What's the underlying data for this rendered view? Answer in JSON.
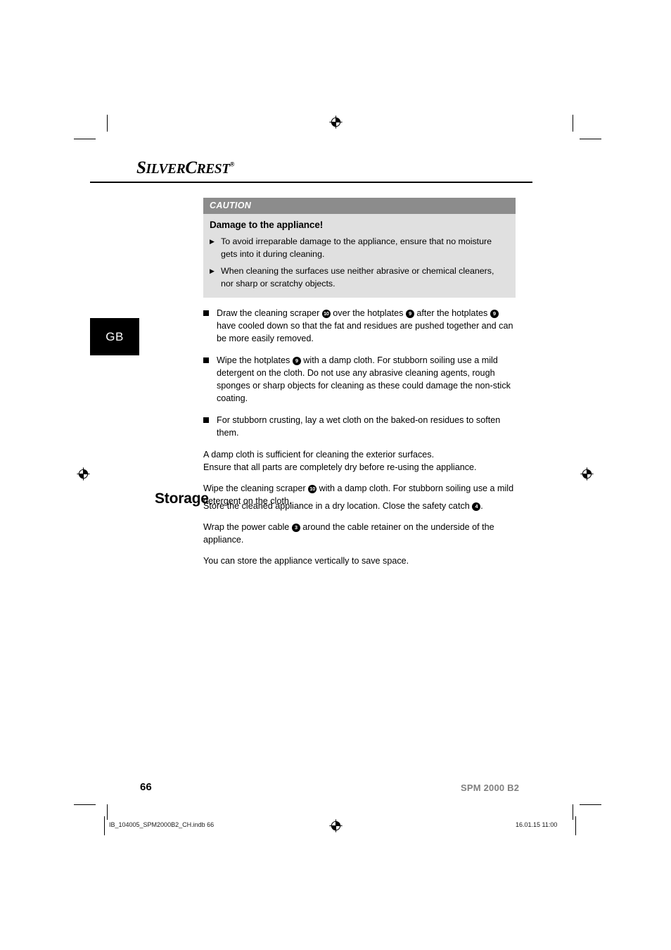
{
  "document": {
    "brand": {
      "name_part1": "S",
      "name_part2": "ILVER",
      "name_part3": "C",
      "name_part4": "REST",
      "registered_symbol": "®"
    },
    "language_tab": "GB"
  },
  "caution": {
    "header": "CAUTION",
    "title": "Damage to the appliance!",
    "items": [
      "To avoid irreparable damage to the appliance, ensure that no moisture gets into it during cleaning.",
      "When cleaning the surfaces use neither abrasive or chemical cleaners, nor sharp or scratchy objects."
    ],
    "arrow_glyph": "▶"
  },
  "cleaning": {
    "bullets": [
      {
        "seg1": "Draw the cleaning scraper ",
        "ref1": "10",
        "seg2": " over the hotplates ",
        "ref2": "9",
        "seg3": " after the hotplates ",
        "ref3": "9",
        "seg4": " have cooled down so that the fat and residues are pushed together and can be more easily removed."
      },
      {
        "seg1": "Wipe the hotplates ",
        "ref1": "9",
        "seg2": " with a damp cloth. For stubborn soiling use a mild detergent on the cloth. Do not use any abrasive cleaning agents, rough sponges or sharp objects for cleaning as these could damage the non-stick coating.",
        "ref2": "",
        "seg3": "",
        "ref3": "",
        "seg4": ""
      },
      {
        "seg1": "For stubborn crusting, lay a wet cloth on the baked-on residues to soften them.",
        "ref1": "",
        "seg2": "",
        "ref2": "",
        "seg3": "",
        "ref3": "",
        "seg4": ""
      }
    ],
    "paragraph_exterior_line1": "A damp cloth is sufficient for cleaning the exterior surfaces.",
    "paragraph_exterior_line2": "Ensure that all parts are completely dry before re-using the appliance.",
    "paragraph_scraper_seg1": "Wipe the cleaning scraper ",
    "paragraph_scraper_ref": "10",
    "paragraph_scraper_seg2": " with a damp cloth. For stubborn soiling use a mild detergent on the cloth."
  },
  "storage": {
    "heading": "Storage",
    "p1_seg1": "Store the cleaned appliance in a dry location. Close the safety catch ",
    "p1_ref": "4",
    "p1_seg2": ".",
    "p2_seg1": "Wrap the power cable ",
    "p2_ref": "3",
    "p2_seg2": " around the cable retainer on the underside of the appliance.",
    "p3": "You can store the appliance vertically to save space."
  },
  "footer": {
    "page_number": "66",
    "model": "SPM 2000 B2",
    "print_file": "IB_104005_SPM2000B2_CH.indb   66",
    "print_timestamp": "16.01.15   11:00"
  }
}
